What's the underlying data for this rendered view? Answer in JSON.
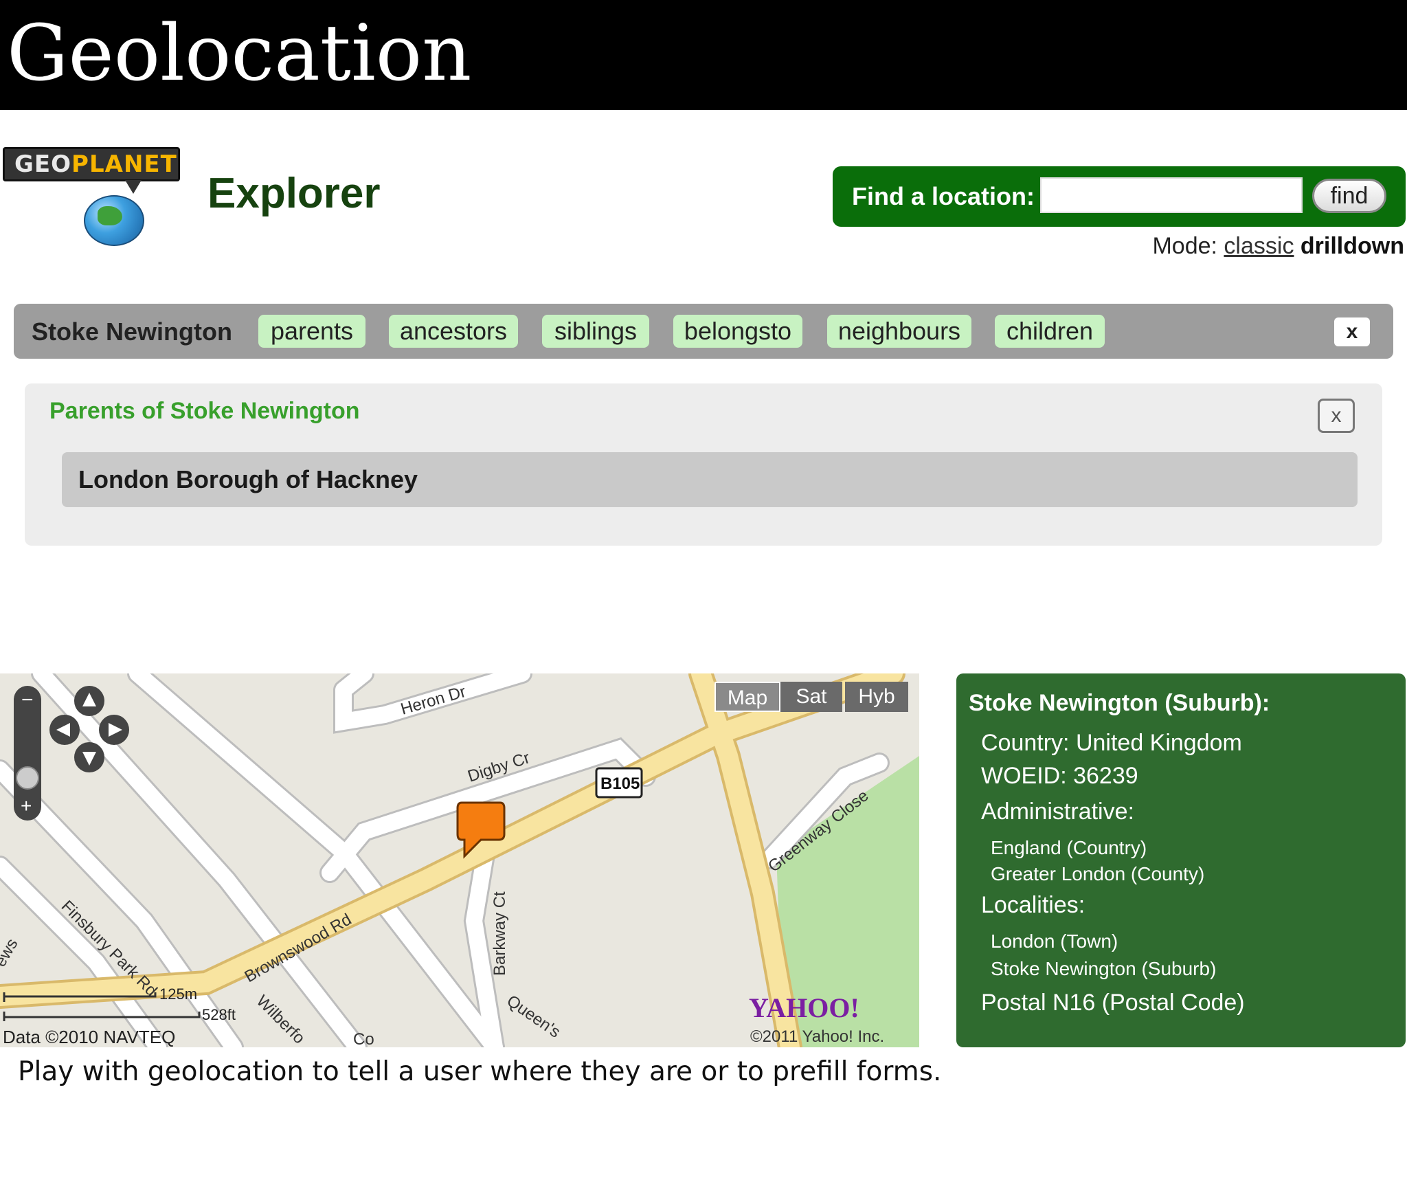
{
  "slide": {
    "title": "Geolocation",
    "caption": "Play with geolocation to tell a user where they are or to prefill forms."
  },
  "header": {
    "logo_geo": "GEO",
    "logo_planet": "PLANET",
    "app_name": "Explorer",
    "find_label": "Find a location:",
    "find_input_value": "",
    "find_button": "find",
    "mode_label": "Mode:",
    "mode_classic": "classic",
    "mode_drilldown": "drilldown"
  },
  "nav": {
    "place": "Stoke Newington",
    "tabs": [
      "parents",
      "ancestors",
      "siblings",
      "belongsto",
      "neighbours",
      "children"
    ],
    "close": "x"
  },
  "parents_panel": {
    "heading": "Parents of Stoke Newington",
    "close": "x",
    "items": [
      "London Borough of Hackney"
    ]
  },
  "map": {
    "types": [
      "Map",
      "Sat",
      "Hyb"
    ],
    "selected_type": "Map",
    "streets": [
      "Heron Dr",
      "Digby Cr",
      "Brownswood Rd",
      "Finsbury Park Rd",
      "Barkway Ct",
      "Greenway Close",
      "Queen's",
      "Wilberfo",
      "Co",
      "ews"
    ],
    "road_sign": "B105",
    "scale_metric": "125m",
    "scale_imperial": "528ft",
    "attribution_data": "Data ©2010 NAVTEQ",
    "attribution_yahoo": "©2011 Yahoo! Inc.",
    "yahoo_logo": "YAHOO!",
    "zoom_minus": "−",
    "zoom_plus": "+"
  },
  "info": {
    "title": "Stoke Newington (Suburb):",
    "country": "Country: United Kingdom",
    "woeid": "WOEID: 36239",
    "administrative_label": "Administrative:",
    "administrative": [
      "England (Country)",
      "Greater London (County)"
    ],
    "localities_label": "Localities:",
    "localities": [
      "London (Town)",
      "Stoke Newington (Suburb)"
    ],
    "postal": "Postal N16 (Postal Code)"
  },
  "colors": {
    "title_bar": "#000000",
    "find_bar": "#0a6e0a",
    "pill": "#c8f2c2",
    "heading_green": "#38a02c",
    "info_panel": "#2f6b2f",
    "map_marker": "#f57d10"
  }
}
